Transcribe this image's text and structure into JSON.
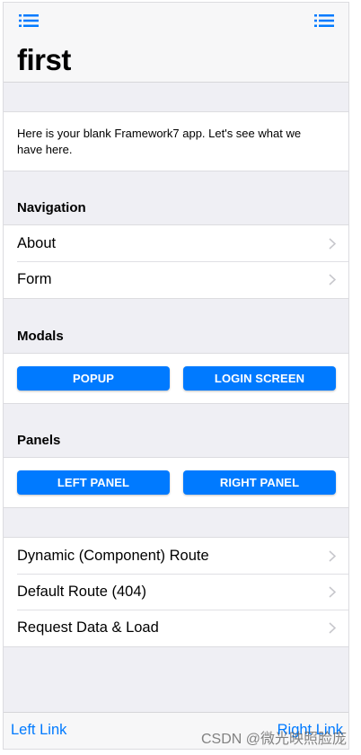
{
  "navbar": {
    "left_icon": "list-icon",
    "right_icon": "list-icon",
    "title": "first"
  },
  "intro": {
    "text": "Here is your blank Framework7 app. Let's see what we have here."
  },
  "navigation": {
    "title": "Navigation",
    "items": [
      {
        "label": "About"
      },
      {
        "label": "Form"
      }
    ]
  },
  "modals": {
    "title": "Modals",
    "buttons": [
      {
        "label": "Popup"
      },
      {
        "label": "Login Screen"
      }
    ]
  },
  "panels": {
    "title": "Panels",
    "buttons": [
      {
        "label": "Left Panel"
      },
      {
        "label": "Right Panel"
      }
    ]
  },
  "routes": {
    "items": [
      {
        "label": "Dynamic (Component) Route"
      },
      {
        "label": "Default Route (404)"
      },
      {
        "label": "Request Data & Load"
      }
    ]
  },
  "toolbar": {
    "left_link": "Left Link",
    "right_link": "Right Link"
  },
  "watermark": "CSDN @微光映照脸庞",
  "colors": {
    "accent": "#007aff",
    "background": "#efeff4",
    "bar": "#f7f7f8"
  }
}
